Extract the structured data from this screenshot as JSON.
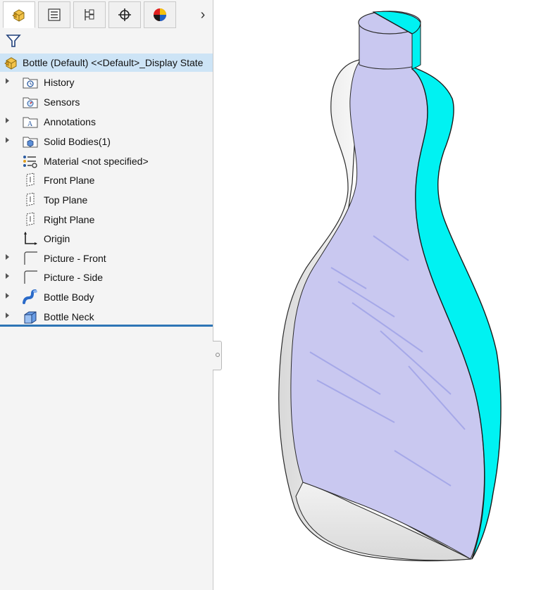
{
  "tabs": [
    {
      "name": "feature-manager-tab",
      "icon": "part-cube-icon",
      "active": true
    },
    {
      "name": "property-manager-tab",
      "icon": "list-icon",
      "active": false
    },
    {
      "name": "configuration-manager-tab",
      "icon": "configuration-icon",
      "active": false
    },
    {
      "name": "dimxpert-manager-tab",
      "icon": "crosshair-icon",
      "active": false
    },
    {
      "name": "display-manager-tab",
      "icon": "appearance-ball-icon",
      "active": false
    }
  ],
  "tab_more": "›",
  "tree": {
    "root_label": "Bottle (Default) <<Default>_Display State",
    "items": [
      {
        "label": "History",
        "expandable": true,
        "icon": "history-folder-icon"
      },
      {
        "label": "Sensors",
        "expandable": false,
        "icon": "sensors-folder-icon"
      },
      {
        "label": "Annotations",
        "expandable": true,
        "icon": "annotations-folder-icon"
      },
      {
        "label": "Solid Bodies(1)",
        "expandable": true,
        "icon": "solid-bodies-folder-icon"
      },
      {
        "label": "Material <not specified>",
        "expandable": false,
        "icon": "material-icon"
      },
      {
        "label": "Front Plane",
        "expandable": false,
        "icon": "plane-icon"
      },
      {
        "label": "Top Plane",
        "expandable": false,
        "icon": "plane-icon"
      },
      {
        "label": "Right Plane",
        "expandable": false,
        "icon": "plane-icon"
      },
      {
        "label": "Origin",
        "expandable": false,
        "icon": "origin-icon"
      },
      {
        "label": "Picture - Front",
        "expandable": true,
        "icon": "sketch-picture-icon"
      },
      {
        "label": "Picture - Side",
        "expandable": true,
        "icon": "sketch-picture-icon"
      },
      {
        "label": "Bottle Body",
        "expandable": true,
        "icon": "loft-feature-icon"
      },
      {
        "label": "Bottle Neck",
        "expandable": true,
        "icon": "extrude-feature-icon"
      }
    ]
  },
  "colors": {
    "selection_highlight": "#cde4f6",
    "tree_end_marker": "#2e75b6",
    "surface_face": "#c9c8f0",
    "cut_face": "#00f2f2"
  }
}
